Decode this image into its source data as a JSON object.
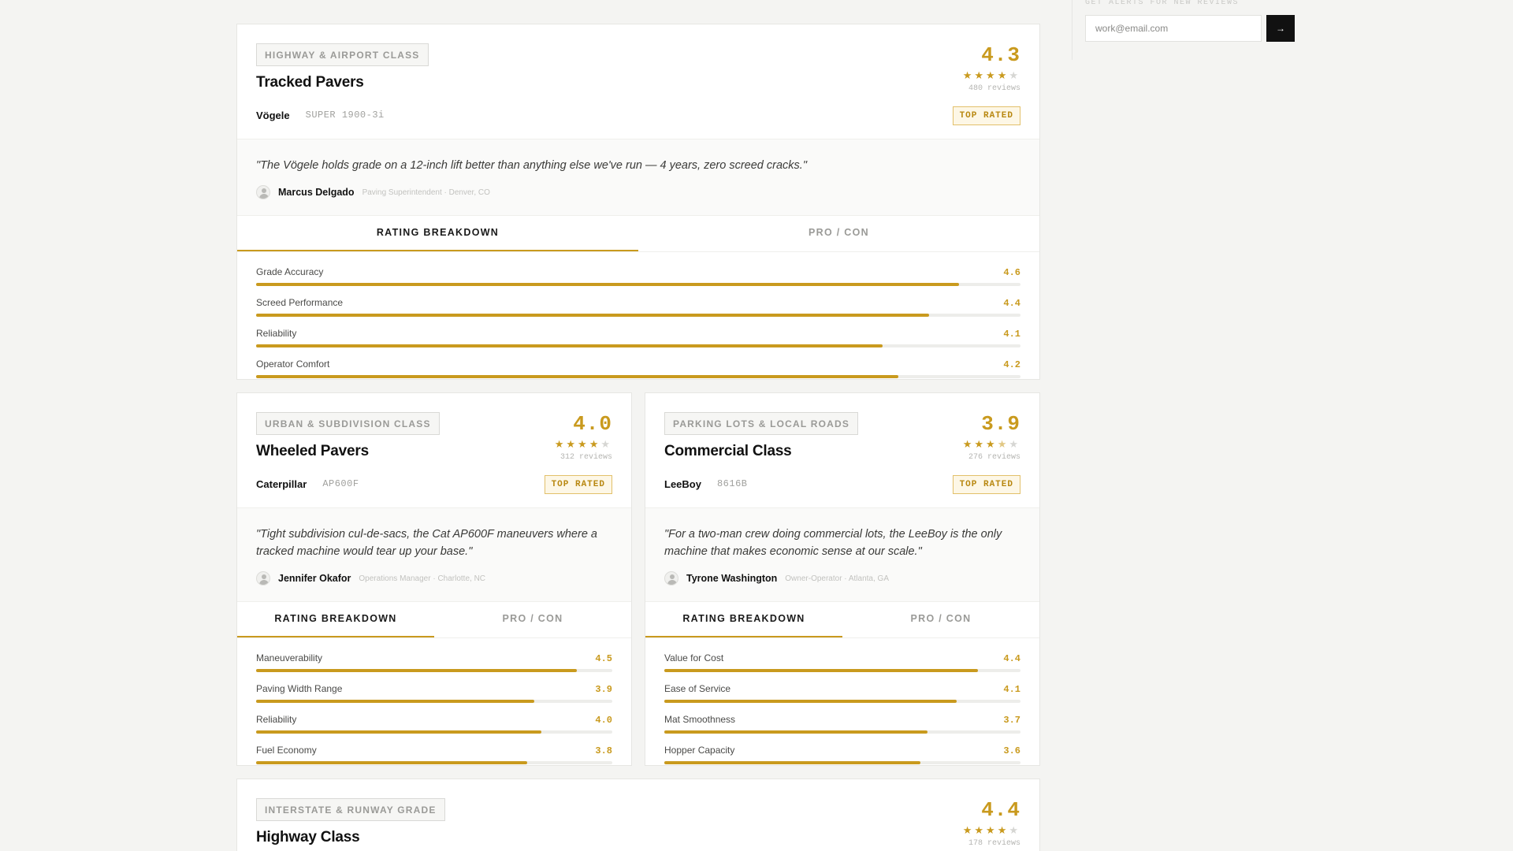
{
  "sidebar": {
    "label": "GET ALERTS FOR NEW REVIEWS",
    "email_placeholder": "work@email.com",
    "submit_label": "→"
  },
  "colors": {
    "accent": "#c99a1e",
    "badge_bg": "#fdf7e6"
  },
  "cards": [
    {
      "class_tag": "HIGHWAY & AIRPORT CLASS",
      "title": "Tracked Pavers",
      "make": "Vögele",
      "model": "SUPER 1900-3i",
      "score": "4.3",
      "stars": 4,
      "reviews": "480 reviews",
      "badge": "TOP RATED",
      "quote": "\"The Vögele holds grade on a 12-inch lift better than anything else we've run — 4 years, zero screed cracks.\"",
      "author": "Marcus Delgado",
      "author_meta": "Paving Superintendent · Denver, CO",
      "tab_active": "RATING BREAKDOWN",
      "tab_other": "PRO / CON",
      "metrics": [
        {
          "label": "Grade Accuracy",
          "value": "4.6",
          "pct": 92
        },
        {
          "label": "Screed Performance",
          "value": "4.4",
          "pct": 88
        },
        {
          "label": "Reliability",
          "value": "4.1",
          "pct": 82
        },
        {
          "label": "Operator Comfort",
          "value": "4.2",
          "pct": 84
        }
      ]
    },
    {
      "class_tag": "URBAN & SUBDIVISION CLASS",
      "title": "Wheeled Pavers",
      "make": "Caterpillar",
      "model": "AP600F",
      "score": "4.0",
      "stars": 4,
      "reviews": "312 reviews",
      "badge": "TOP RATED",
      "quote": "\"Tight subdivision cul-de-sacs, the Cat AP600F maneuvers where a tracked machine would tear up your base.\"",
      "author": "Jennifer Okafor",
      "author_meta": "Operations Manager · Charlotte, NC",
      "tab_active": "RATING BREAKDOWN",
      "tab_other": "PRO / CON",
      "metrics": [
        {
          "label": "Maneuverability",
          "value": "4.5",
          "pct": 90
        },
        {
          "label": "Paving Width Range",
          "value": "3.9",
          "pct": 78
        },
        {
          "label": "Reliability",
          "value": "4.0",
          "pct": 80
        },
        {
          "label": "Fuel Economy",
          "value": "3.8",
          "pct": 76
        }
      ]
    },
    {
      "class_tag": "PARKING LOTS & LOCAL ROADS",
      "title": "Commercial Class",
      "make": "LeeBoy",
      "model": "8616B",
      "score": "3.9",
      "stars": 3,
      "half_star": true,
      "reviews": "276 reviews",
      "badge": "TOP RATED",
      "quote": "\"For a two-man crew doing commercial lots, the LeeBoy is the only machine that makes economic sense at our scale.\"",
      "author": "Tyrone Washington",
      "author_meta": "Owner-Operator · Atlanta, GA",
      "tab_active": "RATING BREAKDOWN",
      "tab_other": "PRO / CON",
      "metrics": [
        {
          "label": "Value for Cost",
          "value": "4.4",
          "pct": 88
        },
        {
          "label": "Ease of Service",
          "value": "4.1",
          "pct": 82
        },
        {
          "label": "Mat Smoothness",
          "value": "3.7",
          "pct": 74
        },
        {
          "label": "Hopper Capacity",
          "value": "3.6",
          "pct": 72
        }
      ]
    },
    {
      "class_tag": "INTERSTATE & RUNWAY GRADE",
      "title": "Highway Class",
      "score": "4.4",
      "stars": 4,
      "reviews": "178 reviews"
    }
  ]
}
